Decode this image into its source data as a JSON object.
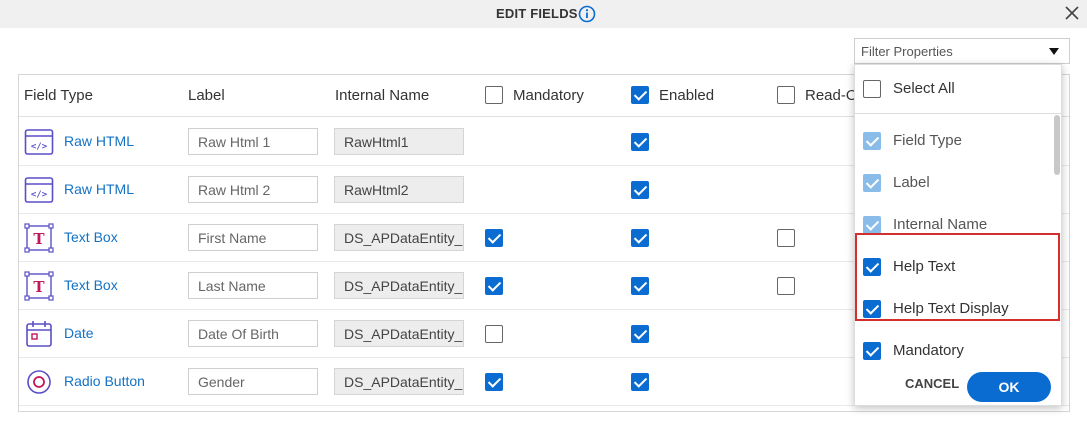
{
  "dialog": {
    "title": "EDIT FIELDS",
    "info_icon": "info-icon",
    "close_icon": "close-icon"
  },
  "filter": {
    "placeholder": "Filter Properties"
  },
  "table": {
    "headers": {
      "field_type": "Field Type",
      "label": "Label",
      "internal_name": "Internal Name",
      "mandatory": "Mandatory",
      "enabled": "Enabled",
      "read_only": "Read-O"
    },
    "header_checks": {
      "mandatory": false,
      "enabled": true,
      "read_only": false
    },
    "rows": [
      {
        "icon": "raw-html-icon",
        "type": "Raw HTML",
        "label": "Raw Html 1",
        "internal": "RawHtml1",
        "mandatory": null,
        "enabled": true,
        "read_only": null
      },
      {
        "icon": "raw-html-icon",
        "type": "Raw HTML",
        "label": "Raw Html 2",
        "internal": "RawHtml2",
        "mandatory": null,
        "enabled": true,
        "read_only": null
      },
      {
        "icon": "text-box-icon",
        "type": "Text Box",
        "label": "First Name",
        "internal": "DS_APDataEntity_(",
        "mandatory": true,
        "enabled": true,
        "read_only": false
      },
      {
        "icon": "text-box-icon",
        "type": "Text Box",
        "label": "Last Name",
        "internal": "DS_APDataEntity_(",
        "mandatory": true,
        "enabled": true,
        "read_only": false
      },
      {
        "icon": "date-icon",
        "type": "Date",
        "label": "Date Of Birth",
        "internal": "DS_APDataEntity_(",
        "mandatory": false,
        "enabled": true,
        "read_only": null
      },
      {
        "icon": "radio-button-icon",
        "type": "Radio Button",
        "label": "Gender",
        "internal": "DS_APDataEntity_(",
        "mandatory": true,
        "enabled": true,
        "read_only": null
      }
    ]
  },
  "dropdown": {
    "items": [
      {
        "label": "Select All",
        "checked": false,
        "disabled": false
      },
      {
        "label": "Field Type",
        "checked": true,
        "disabled": true
      },
      {
        "label": "Label",
        "checked": true,
        "disabled": true
      },
      {
        "label": "Internal Name",
        "checked": true,
        "disabled": true
      },
      {
        "label": "Help Text",
        "checked": true,
        "disabled": false
      },
      {
        "label": "Help Text Display",
        "checked": true,
        "disabled": false
      },
      {
        "label": "Mandatory",
        "checked": true,
        "disabled": false
      }
    ],
    "cancel_label": "CANCEL",
    "ok_label": "OK"
  },
  "colors": {
    "accent": "#0a6cd1",
    "link": "#1372c4",
    "highlight": "#d32f2f",
    "icon_purple": "#5b4fc7",
    "icon_magenta": "#c2185b"
  }
}
